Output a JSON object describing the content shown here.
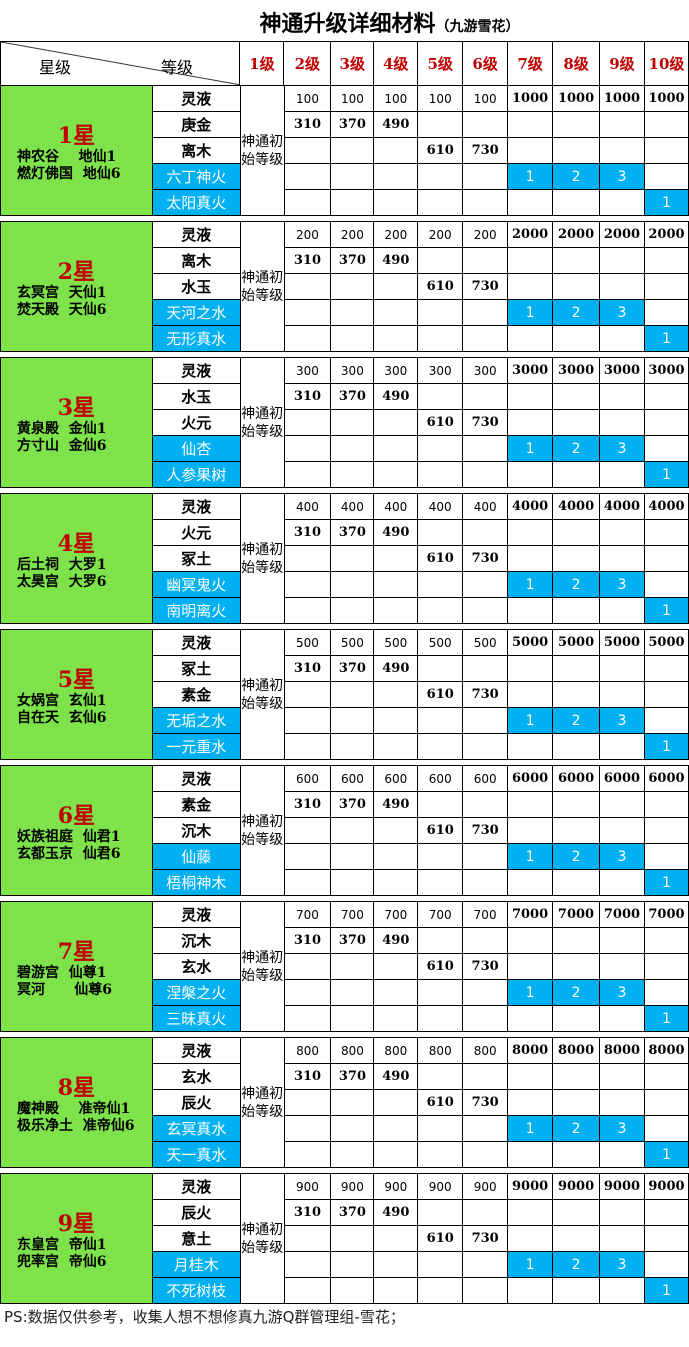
{
  "title": {
    "main": "神通升级详细材料",
    "sub": "（九游雪花）"
  },
  "header": {
    "star_label": "星级",
    "level_label": "等级",
    "levels": [
      "1级",
      "2级",
      "3级",
      "4级",
      "5级",
      "6级",
      "7级",
      "8级",
      "9级",
      "10级"
    ]
  },
  "init_label": "神通初始等级",
  "colors": {
    "star_bg": "#7ee24a",
    "accent_blue": "#00b0f0",
    "level_red": "#c00000"
  },
  "blocks": [
    {
      "star": "1星",
      "loc1": "神农谷    地仙1",
      "loc2": "燃灯佛国  地仙6",
      "mats": [
        "灵液",
        "庚金",
        "离木",
        "六丁神火",
        "太阳真火"
      ],
      "liquid_low": "100",
      "liquid_high": "1000"
    },
    {
      "star": "2星",
      "loc1": "玄冥宫  天仙1",
      "loc2": "焚天殿  天仙6",
      "mats": [
        "灵液",
        "离木",
        "水玉",
        "天河之水",
        "无形真水"
      ],
      "liquid_low": "200",
      "liquid_high": "2000"
    },
    {
      "star": "3星",
      "loc1": "黄泉殿  金仙1",
      "loc2": "方寸山  金仙6",
      "mats": [
        "灵液",
        "水玉",
        "火元",
        "仙杏",
        "人参果树"
      ],
      "liquid_low": "300",
      "liquid_high": "3000"
    },
    {
      "star": "4星",
      "loc1": "后土祠  大罗1",
      "loc2": "太昊宫  大罗6",
      "mats": [
        "灵液",
        "火元",
        "冢土",
        "幽冥鬼火",
        "南明离火"
      ],
      "liquid_low": "400",
      "liquid_high": "4000"
    },
    {
      "star": "5星",
      "loc1": "女娲宫  玄仙1",
      "loc2": "自在天  玄仙6",
      "mats": [
        "灵液",
        "冢土",
        "素金",
        "无垢之水",
        "一元重水"
      ],
      "liquid_low": "500",
      "liquid_high": "5000"
    },
    {
      "star": "6星",
      "loc1": "妖族祖庭  仙君1",
      "loc2": "玄都玉京  仙君6",
      "mats": [
        "灵液",
        "素金",
        "沉木",
        "仙藤",
        "梧桐神木"
      ],
      "liquid_low": "600",
      "liquid_high": "6000"
    },
    {
      "star": "7星",
      "loc1": "碧游宫  仙尊1",
      "loc2": "冥河      仙尊6",
      "mats": [
        "灵液",
        "沉木",
        "玄水",
        "涅槃之火",
        "三昧真火"
      ],
      "liquid_low": "700",
      "liquid_high": "7000"
    },
    {
      "star": "8星",
      "loc1": "魔神殿    准帝仙1",
      "loc2": "极乐净土  准帝仙6",
      "mats": [
        "灵液",
        "玄水",
        "辰火",
        "玄冥真水",
        "天一真水"
      ],
      "liquid_low": "800",
      "liquid_high": "8000"
    },
    {
      "star": "9星",
      "loc1": "东皇宫  帝仙1",
      "loc2": "兜率宫  帝仙6",
      "mats": [
        "灵液",
        "辰火",
        "意土",
        "月桂木",
        "不死树枝"
      ],
      "liquid_low": "900",
      "liquid_high": "9000"
    }
  ],
  "common": {
    "mat2_values": [
      "310",
      "370",
      "490"
    ],
    "mat3_values": [
      "610",
      "730"
    ],
    "mat4_values": [
      "1",
      "2",
      "3"
    ],
    "mat5_values": [
      "1"
    ]
  },
  "footer": "PS:数据仅供参考，收集人想不想修真九游Q群管理组-雪花；"
}
